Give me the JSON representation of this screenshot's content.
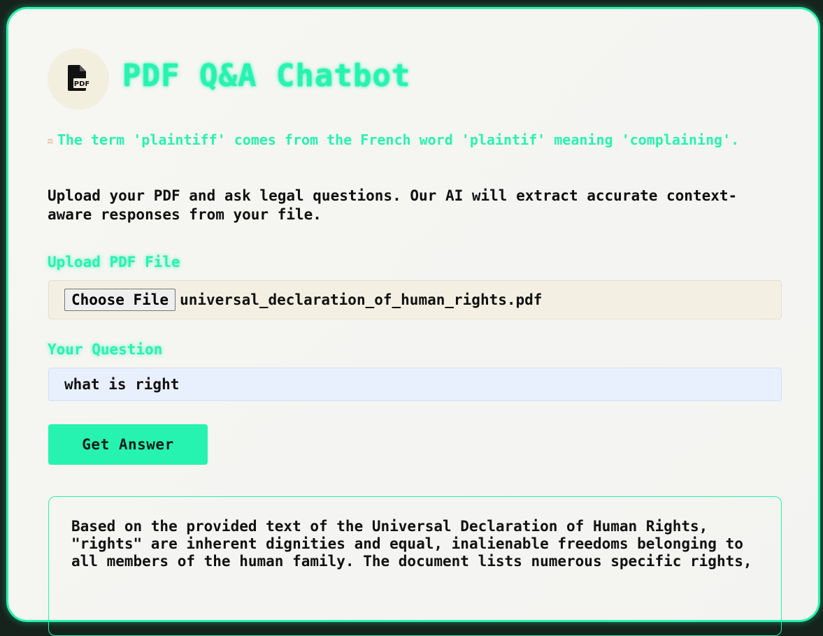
{
  "app": {
    "title": "PDF Q&A Chatbot",
    "logo_icon": "pdf-file-icon",
    "logo_text": "PDF"
  },
  "fact": {
    "icon": "balance-scale-icon",
    "text": "The term 'plaintiff' comes from the French word 'plaintif' meaning 'complaining'."
  },
  "intro": "Upload your PDF and ask legal questions. Our AI will extract accurate context-aware responses from your file.",
  "upload": {
    "label": "Upload PDF File",
    "button_label": "Choose File",
    "file_name": "universal_declaration_of_human_rights.pdf"
  },
  "question": {
    "label": "Your Question",
    "value": "what is right"
  },
  "submit_label": "Get Answer",
  "answer": "Based on the provided text of the Universal Declaration of Human Rights, \"rights\" are inherent dignities and equal, inalienable freedoms belonging to all members of the human family. The document lists numerous specific rights,",
  "colors": {
    "accent": "#27f3b0",
    "background": "#16231d",
    "card": "#f6f6f3",
    "input_bg": "#e8f0fe",
    "file_bg": "#f3f0e3"
  }
}
